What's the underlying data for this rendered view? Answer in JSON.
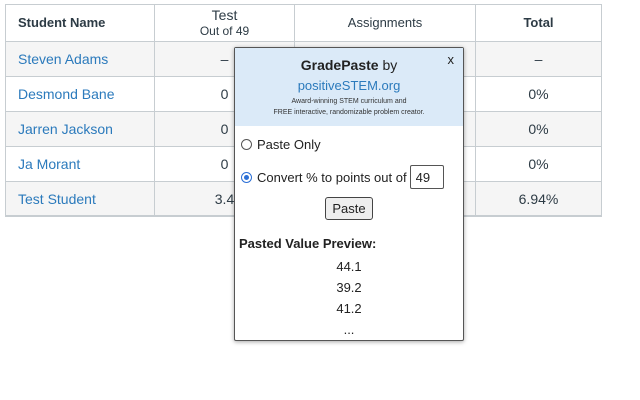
{
  "table": {
    "headers": {
      "student_name": "Student Name",
      "test_title": "Test",
      "test_subtitle": "Out of 49",
      "assignments": "Assignments",
      "total": "Total"
    },
    "rows": [
      {
        "name": "Steven Adams",
        "test": "–",
        "total": "–"
      },
      {
        "name": "Desmond Bane",
        "test": "0",
        "total": "0%"
      },
      {
        "name": "Jarren Jackson",
        "test": "0",
        "total": "0%"
      },
      {
        "name": "Ja Morant",
        "test": "0",
        "total": "0%"
      },
      {
        "name": "Test Student",
        "test": "3.4",
        "total": "6.94%"
      }
    ]
  },
  "popup": {
    "title_bold": "GradePaste",
    "title_suffix": " by",
    "link": "positiveSTEM.org",
    "tagline1": "Award-winning STEM curriculum and",
    "tagline2": "FREE interactive, randomizable problem creator.",
    "close_label": "x",
    "option_paste_only": "Paste Only",
    "option_convert": "Convert % to points out of",
    "points_value": "49",
    "selected_option": "convert",
    "paste_label": "Paste",
    "preview_title": "Pasted Value Preview:",
    "preview_values": [
      "44.1",
      "39.2",
      "41.2",
      "..."
    ]
  },
  "colors": {
    "link": "#2b7abc",
    "popup_header": "#dbeaf8",
    "radio_selected": "#2b6fd6"
  }
}
